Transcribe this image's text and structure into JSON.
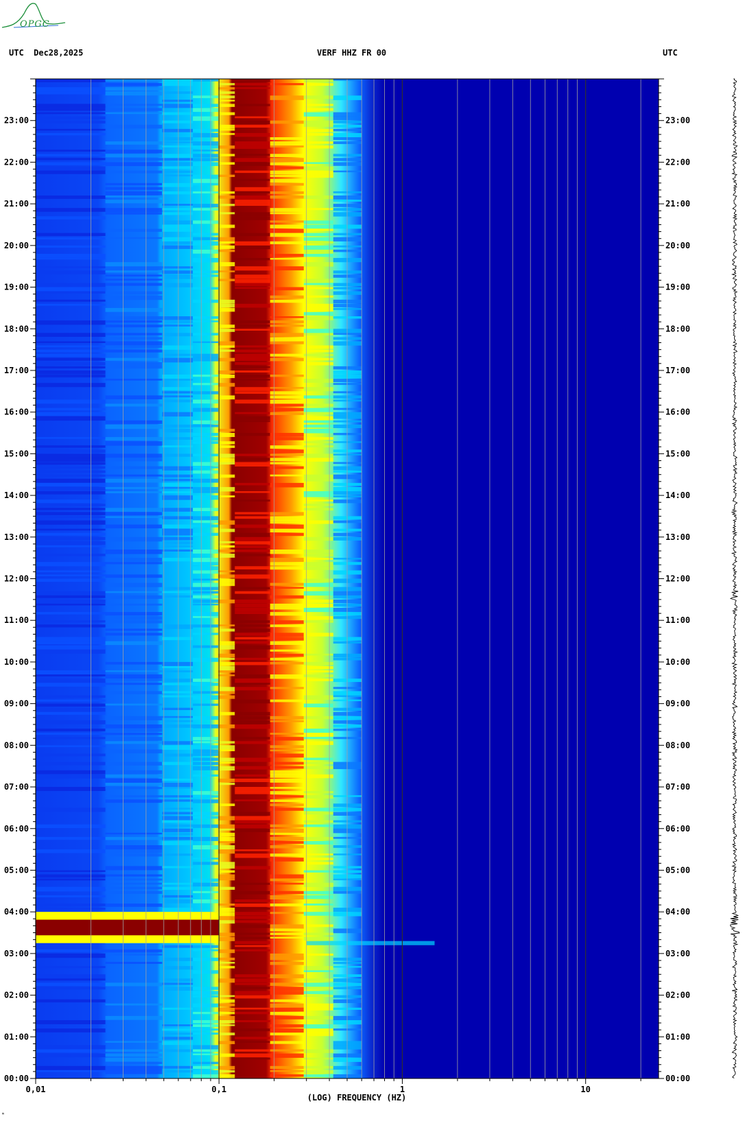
{
  "header": {
    "left": "UTC  Dec28,2025",
    "center": "VERF HHZ FR 00",
    "right": "UTC"
  },
  "logo": {
    "text": "OPGC",
    "color": "#1c8f3a"
  },
  "footnote": "ᵐ",
  "colors": {
    "background": "#0000b0",
    "low": "#0a1ea8",
    "mid_low": "#0a64ff",
    "cyan": "#00d6ff",
    "green_yellow": "#c8ff30",
    "yellow": "#ffff00",
    "orange": "#ff9a00",
    "red": "#ff2200",
    "dark_red": "#8a0000",
    "grid": "#a0a0a0",
    "trace": "#000000"
  },
  "chart_data": {
    "type": "heatmap",
    "title": "VERF HHZ FR 00",
    "subtitle": "UTC  Dec28,2025",
    "xlabel": "(LOG) FREQUENCY (HZ)",
    "ylabel": "",
    "x_scale": "log",
    "xlim": [
      0.01,
      25
    ],
    "x_ticks": [
      {
        "value": 0.01,
        "label": "0,01"
      },
      {
        "value": 0.1,
        "label": "0,1"
      },
      {
        "value": 1,
        "label": "1"
      },
      {
        "value": 10,
        "label": "10"
      }
    ],
    "y_axis_hours": [
      0,
      24
    ],
    "y_ticks": [
      {
        "hour": 0,
        "label": "00:00"
      },
      {
        "hour": 1,
        "label": "01:00"
      },
      {
        "hour": 2,
        "label": "02:00"
      },
      {
        "hour": 3,
        "label": "03:00"
      },
      {
        "hour": 4,
        "label": "04:00"
      },
      {
        "hour": 5,
        "label": "05:00"
      },
      {
        "hour": 6,
        "label": "06:00"
      },
      {
        "hour": 7,
        "label": "07:00"
      },
      {
        "hour": 8,
        "label": "08:00"
      },
      {
        "hour": 9,
        "label": "09:00"
      },
      {
        "hour": 10,
        "label": "10:00"
      },
      {
        "hour": 11,
        "label": "11:00"
      },
      {
        "hour": 12,
        "label": "12:00"
      },
      {
        "hour": 13,
        "label": "13:00"
      },
      {
        "hour": 14,
        "label": "14:00"
      },
      {
        "hour": 15,
        "label": "15:00"
      },
      {
        "hour": 16,
        "label": "16:00"
      },
      {
        "hour": 17,
        "label": "17:00"
      },
      {
        "hour": 18,
        "label": "18:00"
      },
      {
        "hour": 19,
        "label": "19:00"
      },
      {
        "hour": 20,
        "label": "20:00"
      },
      {
        "hour": 21,
        "label": "21:00"
      },
      {
        "hour": 22,
        "label": "22:00"
      },
      {
        "hour": 23,
        "label": "23:00"
      }
    ],
    "frequency_bands": [
      {
        "f_lo": 0.01,
        "f_hi": 0.024,
        "level": "blue"
      },
      {
        "f_lo": 0.024,
        "f_hi": 0.049,
        "level": "blue-light"
      },
      {
        "f_lo": 0.049,
        "f_hi": 0.072,
        "level": "cyan-blue"
      },
      {
        "f_lo": 0.072,
        "f_hi": 0.099,
        "level": "cyan"
      },
      {
        "f_lo": 0.099,
        "f_hi": 0.122,
        "level": "yellow-orange"
      },
      {
        "f_lo": 0.122,
        "f_hi": 0.19,
        "level": "dark-red"
      },
      {
        "f_lo": 0.19,
        "f_hi": 0.29,
        "level": "orange-yellow"
      },
      {
        "f_lo": 0.29,
        "f_hi": 0.42,
        "level": "yellow-green"
      },
      {
        "f_lo": 0.42,
        "f_hi": 0.6,
        "level": "cyan-blue"
      },
      {
        "f_lo": 0.6,
        "f_hi": 25,
        "level": "background"
      }
    ],
    "events": [
      {
        "hour_start": 3.25,
        "hour_end": 4.0,
        "f_lo": 0.01,
        "f_hi": 0.1,
        "description_level": "dark-red"
      },
      {
        "hour_start": 3.2,
        "hour_end": 3.3,
        "f_lo": 0.3,
        "f_hi": 1.5,
        "description_level": "cyan"
      }
    ],
    "grid": true
  }
}
